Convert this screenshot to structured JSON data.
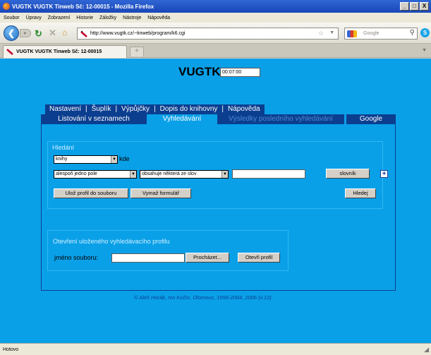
{
  "window": {
    "title": "VUGTK VUGTK Tinweb Sč: 12-00015 - Mozilla Firefox",
    "controls": [
      "_",
      "□",
      "X"
    ]
  },
  "menubar": {
    "items": [
      "Soubor",
      "Úpravy",
      "Zobrazení",
      "Historie",
      "Záložky",
      "Nástroje",
      "Nápověda"
    ]
  },
  "navbar": {
    "url": "http://www.vugtk.cz/~tinweb/program/k6.cgi",
    "search_placeholder": "Google"
  },
  "tabs": {
    "active_label": "VUGTK VUGTK Tinweb Sč: 12-00015",
    "new_tab": "+"
  },
  "page": {
    "title": "VUGTK",
    "timer": "00:07:00",
    "menu_row1": [
      "Nastavení",
      "Šuplík",
      "Výpůjčky",
      "Dopis do knihovny",
      "Nápověda"
    ],
    "menu_row2": [
      {
        "label": "Listování v seznamech",
        "state": "normal"
      },
      {
        "label": "Vyhledávání",
        "state": "active"
      },
      {
        "label": "Výsledky posledního vyhledávání",
        "state": "disabled"
      },
      {
        "label": "Google",
        "state": "normal"
      }
    ],
    "search": {
      "legend": "Hledání",
      "scope_value": "knihy",
      "scope_suffix": "kde",
      "field_value": "alespoň jedno pole",
      "operator_value": "obsahuje některá ze slov",
      "query_value": "",
      "dictionary_button": "slovník",
      "add_button": "+",
      "save_profile_button": "Ulož profil do souboru",
      "clear_form_button": "Vymaž formulář",
      "search_button": "Hledej"
    },
    "profile": {
      "legend": "Otevření uloženého vyhledávacího profilu",
      "file_label": "jméno souboru:",
      "file_value": "",
      "browse_button": "Procházet...",
      "open_button": "Otevři profil"
    },
    "footer": "© Aleš Horák, Ivo Kučin, Olomouc, 1996-2004, 2006 (v.12)"
  },
  "statusbar": {
    "text": "Hotovo"
  },
  "colors": {
    "page_bg": "#0aa0e8",
    "menu_bg": "#0b3e8f",
    "legend_text": "#cfefff"
  }
}
